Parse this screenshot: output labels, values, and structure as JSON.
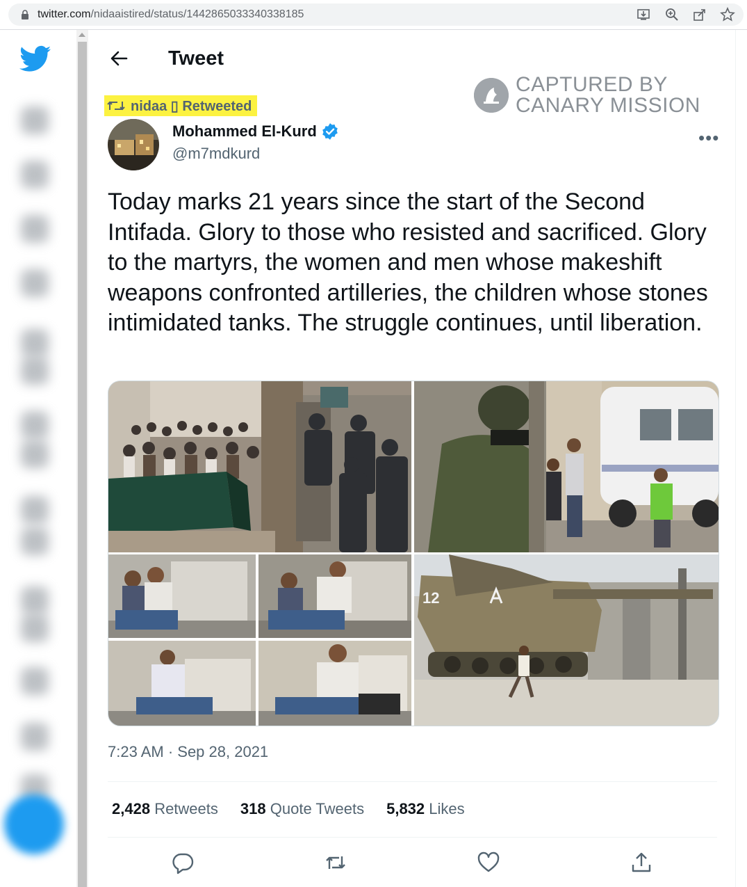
{
  "browser": {
    "url_host": "twitter.com",
    "url_path": "/nidaaistired/status/1442865033340338185",
    "icons": [
      "lock-icon",
      "install-icon",
      "zoom-icon",
      "share-icon",
      "bookmark-star-icon"
    ]
  },
  "sidebar": {
    "logo": "twitter-bird-icon",
    "accent": "#1d9bf0"
  },
  "header": {
    "title": "Tweet"
  },
  "watermark": {
    "line1": "CAPTURED BY",
    "line2": "CANARY MISSION"
  },
  "retweet": {
    "text": "nidaa ▯ Retweeted",
    "highlight": "#fcf241"
  },
  "author": {
    "name": "Mohammed El-Kurd",
    "handle": "@m7mdkurd",
    "verified": true
  },
  "more_label": "•••",
  "tweet": {
    "text": "Today marks 21 years since the start of the Second Intifada. Glory to those who resisted and sacrificed. Glory to the martyrs, the women and men whose makeshift weapons confronted artilleries, the children whose stones intimidated tanks. The struggle continues, until liberation.",
    "timestamp": "7:23 AM · Sep 28, 2021"
  },
  "media": {
    "images": [
      "crowd-and-police-photo",
      "soldier-and-stone-throwers-photo",
      "father-and-son-sequence-photo",
      "boy-facing-tank-photo"
    ],
    "tank_marking": "12"
  },
  "stats": [
    {
      "count": "2,428",
      "label": "Retweets"
    },
    {
      "count": "318",
      "label": "Quote Tweets"
    },
    {
      "count": "5,832",
      "label": "Likes"
    }
  ],
  "actions": [
    "reply-icon",
    "retweet-icon",
    "like-icon",
    "share-icon"
  ]
}
